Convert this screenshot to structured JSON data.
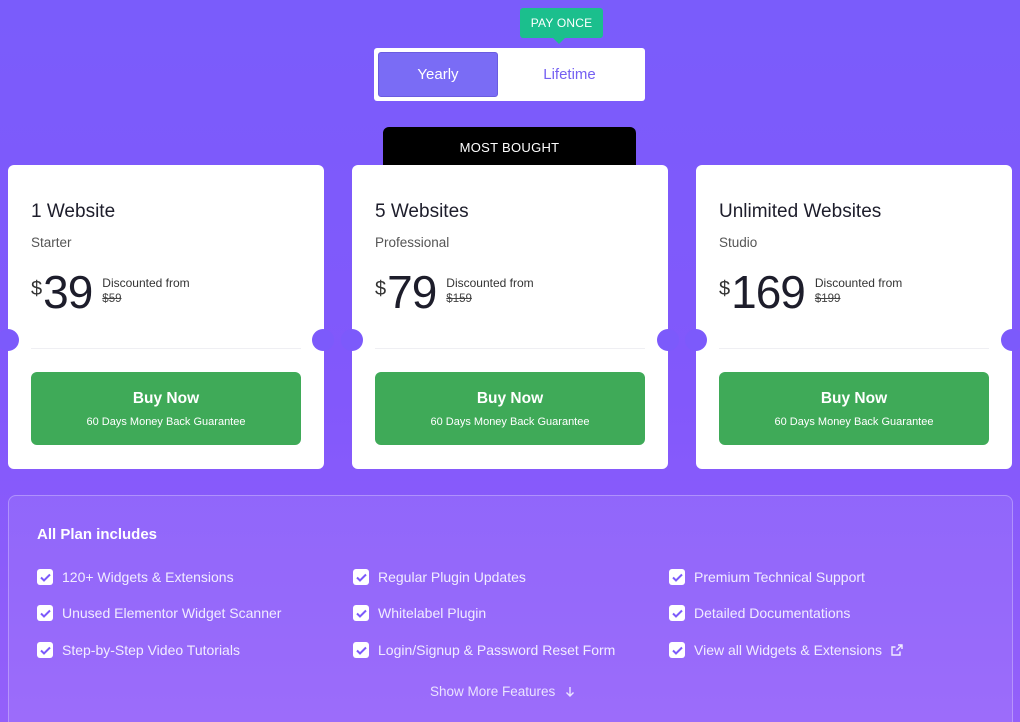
{
  "billing_toggle": {
    "badge": "PAY ONCE",
    "yearly_label": "Yearly",
    "lifetime_label": "Lifetime"
  },
  "most_bought_label": "MOST BOUGHT",
  "plans": [
    {
      "title": "1 Website",
      "subtitle": "Starter",
      "currency": "$",
      "price": "39",
      "discount_label": "Discounted from",
      "old_price": "$59",
      "button_label": "Buy Now",
      "button_sub": "60 Days Money Back Guarantee"
    },
    {
      "title": "5 Websites",
      "subtitle": "Professional",
      "currency": "$",
      "price": "79",
      "discount_label": "Discounted from",
      "old_price": "$159",
      "button_label": "Buy Now",
      "button_sub": "60 Days Money Back Guarantee"
    },
    {
      "title": "Unlimited Websites",
      "subtitle": "Studio",
      "currency": "$",
      "price": "169",
      "discount_label": "Discounted from",
      "old_price": "$199",
      "button_label": "Buy Now",
      "button_sub": "60 Days Money Back Guarantee"
    }
  ],
  "features": {
    "title": "All Plan includes",
    "items": [
      "120+ Widgets & Extensions",
      "Regular Plugin Updates",
      "Premium Technical Support",
      "Unused Elementor Widget Scanner",
      "Whitelabel Plugin",
      "Detailed Documentations",
      "Step-by-Step Video Tutorials",
      "Login/Signup & Password Reset Form",
      "View all Widgets & Extensions"
    ],
    "show_more": "Show More Features"
  },
  "colors": {
    "accent_purple": "#7a6cf5",
    "pay_once_green": "#1bbf8d",
    "buy_green": "#3faa58"
  },
  "icons": {
    "check": "check-icon",
    "external_link": "external-link-icon",
    "arrow_down": "arrow-down-icon"
  }
}
